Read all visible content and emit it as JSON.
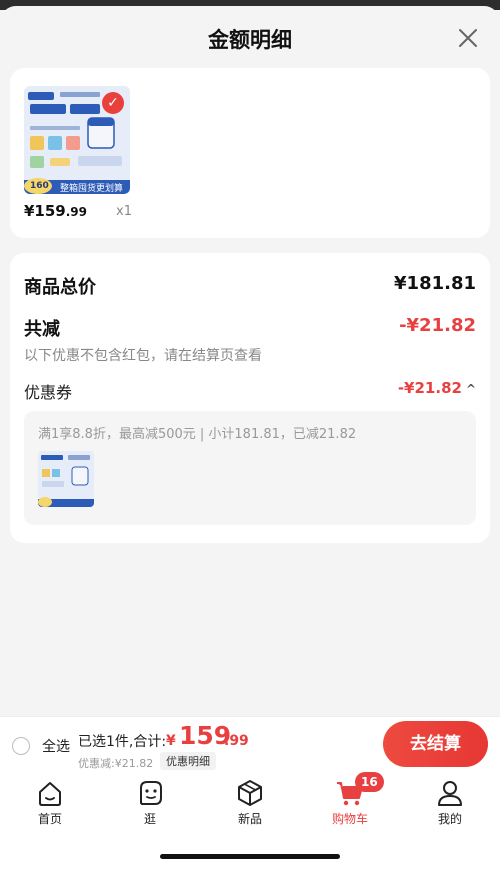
{
  "sheet": {
    "title": "金额明细"
  },
  "product": {
    "price_int": "¥159",
    "price_dec": ".99",
    "qty": "x1",
    "thumb_text": "整箱囤货更划算",
    "thumb_badge": "160"
  },
  "summary": {
    "total_label": "商品总价",
    "total_value": "¥181.81",
    "reduce_label": "共减",
    "reduce_value": "-¥21.82",
    "reduce_note": "以下优惠不包含红包，请在结算页查看",
    "coupon_label": "优惠券",
    "coupon_value": "-¥21.82",
    "coupon_caret": "^",
    "coupon_desc": "满1享8.8折，最高减500元 | 小计181.81，已减21.82"
  },
  "bottom_bar": {
    "select_all": "全选",
    "selected_info": "已选1件,合计:",
    "currency": "¥",
    "total_int": "159",
    "total_dec": ".99",
    "discount": "优惠减:¥21.82",
    "detail_badge": "优惠明细",
    "checkout": "去结算"
  },
  "tabs": [
    {
      "label": "首页",
      "icon": "home-icon"
    },
    {
      "label": "逛",
      "icon": "face-icon"
    },
    {
      "label": "新品",
      "icon": "box-icon"
    },
    {
      "label": "购物车",
      "icon": "cart-icon",
      "badge": "16",
      "active": true
    },
    {
      "label": "我的",
      "icon": "person-icon"
    }
  ],
  "colors": {
    "accent": "#e84040"
  }
}
